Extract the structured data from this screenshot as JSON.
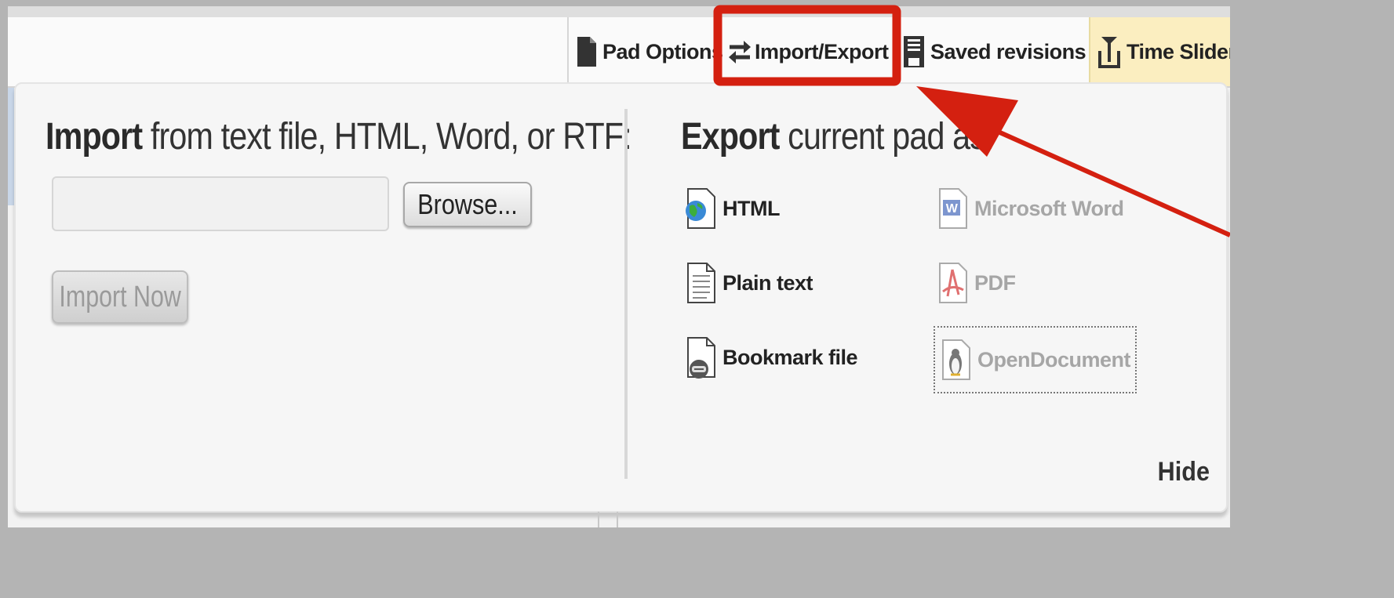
{
  "toolbar": {
    "pad_options": "Pad Options",
    "import_export": "Import/Export",
    "saved_revisions": "Saved revisions",
    "time_slider": "Time Slider"
  },
  "import": {
    "title_bold": "Import",
    "title_rest": " from text file, HTML, Word, or RTF:",
    "browse_label": "Browse...",
    "import_now_label": "Import Now"
  },
  "export": {
    "title_bold": "Export",
    "title_rest": " current pad as:",
    "html": "HTML",
    "plain_text": "Plain text",
    "bookmark_file": "Bookmark file",
    "microsoft_word": "Microsoft Word",
    "pdf": "PDF",
    "opendocument": "OpenDocument"
  },
  "hide_label": "Hide",
  "colors": {
    "annotation_red": "#d42010",
    "time_slider_bg": "#fbeec0",
    "disabled_text": "#a6a6a6"
  }
}
